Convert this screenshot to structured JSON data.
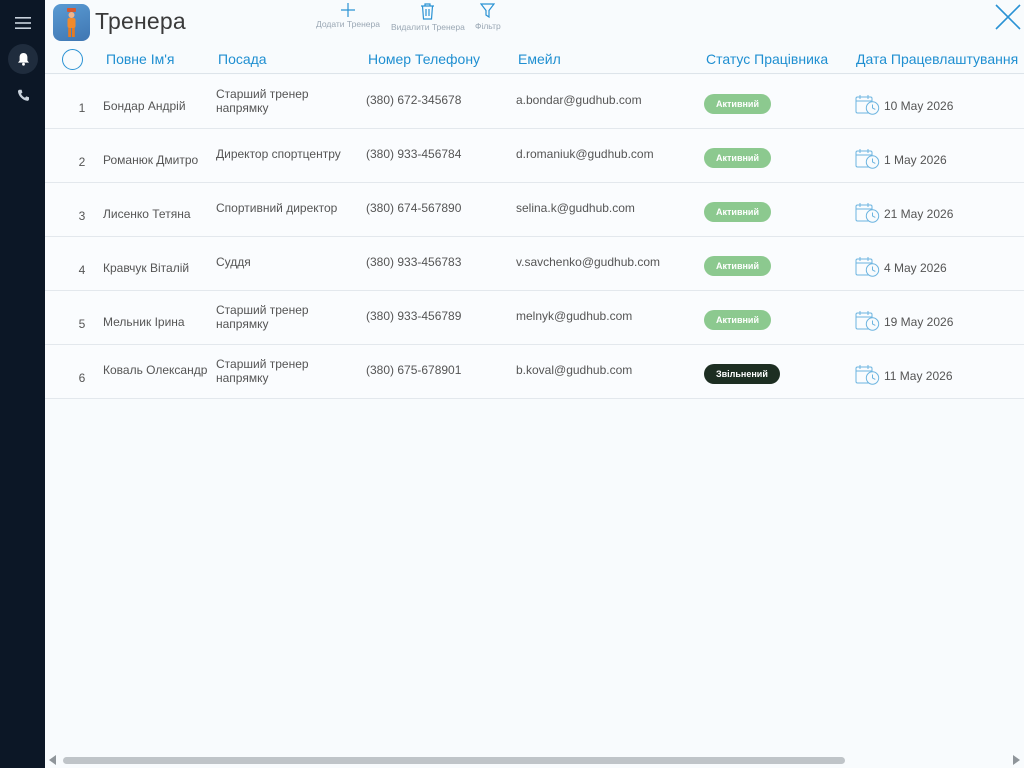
{
  "app": {
    "title": "Тренера"
  },
  "toolbar": {
    "add_label": "Додати Тренера",
    "delete_label": "Видалити Тренера",
    "filter_label": "Фільтр"
  },
  "columns": {
    "name": "Повне Ім'я",
    "position": "Посада",
    "phone": "Номер Телефону",
    "email": "Емейл",
    "status": "Статус Працівника",
    "hire_date": "Дата Працевлаштування"
  },
  "rows": [
    {
      "num": "1",
      "name": "Бондар Андрій",
      "position": "Старший тренер напрямку",
      "phone": "(380) 672-345678",
      "email": "a.bondar@gudhub.com",
      "status": "Активний",
      "status_type": "active",
      "date": "10 May 2026"
    },
    {
      "num": "2",
      "name": "Романюк Дмитро",
      "position": "Директор спортцентру",
      "phone": "(380) 933-456784",
      "email": "d.romaniuk@gudhub.com",
      "status": "Активний",
      "status_type": "active",
      "date": "1 May 2026"
    },
    {
      "num": "3",
      "name": "Лисенко Тетяна",
      "position": "Спортивний директор",
      "phone": "(380) 674-567890",
      "email": "selina.k@gudhub.com",
      "status": "Активний",
      "status_type": "active",
      "date": "21 May 2026"
    },
    {
      "num": "4",
      "name": "Кравчук Віталій",
      "position": "Суддя",
      "phone": "(380) 933-456783",
      "email": "v.savchenko@gudhub.com",
      "status": "Активний",
      "status_type": "active",
      "date": "4 May 2026"
    },
    {
      "num": "5",
      "name": "Мельник Ірина",
      "position": "Старший тренер напрямку",
      "phone": "(380) 933-456789",
      "email": "melnyk@gudhub.com",
      "status": "Активний",
      "status_type": "active",
      "date": "19 May 2026"
    },
    {
      "num": "6",
      "name": "Коваль Олександр",
      "position": "Старший тренер напрямку",
      "phone": "(380) 675-678901",
      "email": "b.koval@gudhub.com",
      "status": "Звільнений",
      "status_type": "fired",
      "date": "11 May 2026"
    }
  ],
  "icons": {
    "rail": [
      "menu-icon",
      "bell-icon",
      "phone-icon"
    ],
    "toolbar": [
      "plus-icon",
      "trash-icon",
      "filter-icon"
    ],
    "close": "close-icon",
    "row_date": "calendar-clock-icon"
  },
  "colors": {
    "rail_bg": "#0c1726",
    "accent": "#1f8fd1",
    "status_active": "#8cc98f",
    "status_fired": "#1d2e22"
  }
}
